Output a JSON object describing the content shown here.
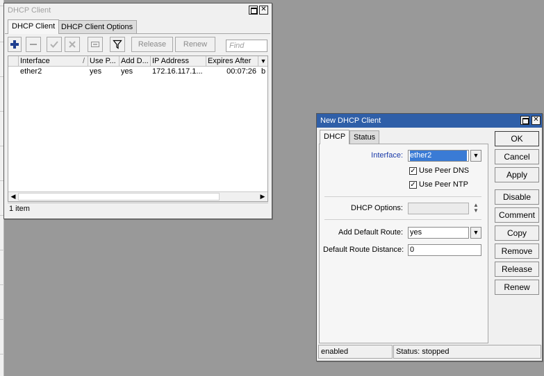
{
  "window1": {
    "title": "DHCP Client",
    "tabs": [
      "DHCP Client",
      "DHCP Client Options"
    ],
    "toolbar": {
      "add_icon": "plus-icon",
      "remove_icon": "minus-icon",
      "enable_icon": "check-icon",
      "disable_icon": "x-icon",
      "comment_icon": "comment-icon",
      "filter_icon": "filter-icon",
      "release_label": "Release",
      "renew_label": "Renew",
      "find_placeholder": "Find"
    },
    "table": {
      "columns": [
        "Interface",
        "Use P...",
        "Add D...",
        "IP Address",
        "Expires After"
      ],
      "sort_indicator": "/",
      "rows": [
        {
          "interface": "ether2",
          "use_peer": "yes",
          "add_default": "yes",
          "ip": "172.16.117.1...",
          "expires": "00:07:26",
          "extra": "b"
        }
      ]
    },
    "status": "1 item"
  },
  "window2": {
    "title": "New DHCP Client",
    "tabs": [
      "DHCP",
      "Status"
    ],
    "form": {
      "interface_label": "Interface:",
      "interface_value": "ether2",
      "use_peer_dns_label": "Use Peer DNS",
      "use_peer_ntp_label": "Use Peer NTP",
      "dhcp_options_label": "DHCP Options:",
      "dhcp_options_value": "",
      "add_default_route_label": "Add Default Route:",
      "add_default_route_value": "yes",
      "default_route_distance_label": "Default Route Distance:",
      "default_route_distance_value": "0"
    },
    "buttons": {
      "ok": "OK",
      "cancel": "Cancel",
      "apply": "Apply",
      "disable": "Disable",
      "comment": "Comment",
      "copy": "Copy",
      "remove": "Remove",
      "release": "Release",
      "renew": "Renew"
    },
    "status": {
      "left": "enabled",
      "right": "Status: stopped"
    }
  },
  "colors": {
    "active_title": "#2f5fa8",
    "desktop": "#999999",
    "add_icon": "#1f3f8f",
    "field_selected": "#3a7bd5"
  }
}
